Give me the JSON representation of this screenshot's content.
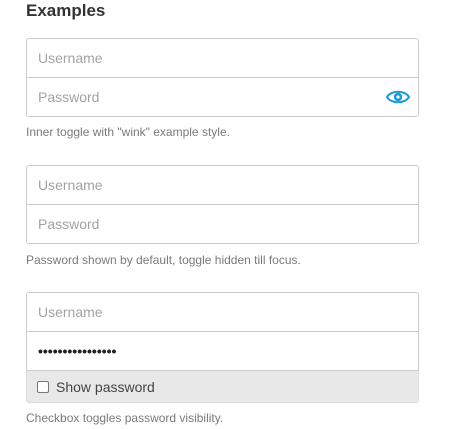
{
  "heading": "Examples",
  "colors": {
    "accent": "#1a9ad6",
    "border": "#cccccc",
    "caption": "#7a7a7a"
  },
  "examples": [
    {
      "username_placeholder": "Username",
      "password_placeholder": "Password",
      "toggle_icon": "eye-icon",
      "caption": "Inner toggle with \"wink\" example style."
    },
    {
      "username_placeholder": "Username",
      "password_placeholder": "Password",
      "caption": "Password shown by default, toggle hidden till focus."
    },
    {
      "username_placeholder": "Username",
      "password_value": "••••••••••••••••",
      "checkbox_label": "Show password",
      "checkbox_checked": false,
      "caption": "Checkbox toggles password visibility."
    }
  ]
}
